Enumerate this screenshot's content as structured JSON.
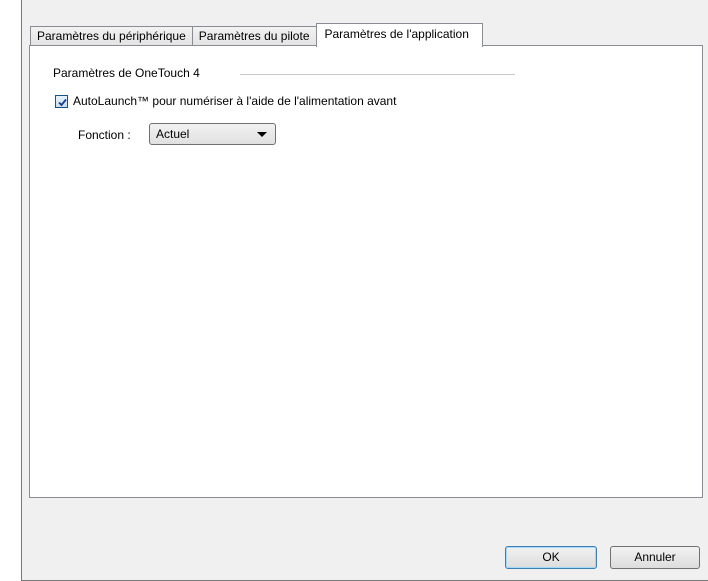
{
  "tabs": [
    {
      "label": "Paramètres du périphérique",
      "active": false
    },
    {
      "label": "Paramètres du pilote",
      "active": false
    },
    {
      "label": "Paramètres de l'application",
      "active": true
    }
  ],
  "group": {
    "title": "Paramètres de OneTouch 4"
  },
  "autolaunch": {
    "label": "AutoLaunch™ pour numériser à l'aide de l'alimentation avant",
    "checked": true
  },
  "function": {
    "label": "Fonction :",
    "selected": "Actuel"
  },
  "buttons": {
    "ok": "OK",
    "cancel": "Annuler"
  },
  "colors": {
    "dialog_bg": "#f0f0f0",
    "panel_bg": "#ffffff",
    "border": "#898c95",
    "ok_focus": "#3c7fb1"
  }
}
